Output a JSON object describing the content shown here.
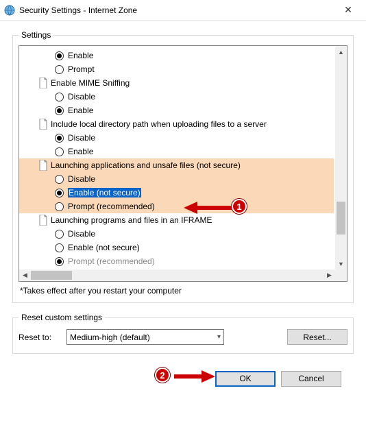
{
  "window": {
    "title": "Security Settings - Internet Zone",
    "close": "✕"
  },
  "settings": {
    "legend": "Settings",
    "groups": [
      {
        "type": "opt",
        "label": "Enable",
        "checked": true
      },
      {
        "type": "opt",
        "label": "Prompt",
        "checked": false
      },
      {
        "type": "grp",
        "label": "Enable MIME Sniffing"
      },
      {
        "type": "opt",
        "label": "Disable",
        "checked": false
      },
      {
        "type": "opt",
        "label": "Enable",
        "checked": true
      },
      {
        "type": "grp",
        "label": "Include local directory path when uploading files to a server"
      },
      {
        "type": "opt",
        "label": "Disable",
        "checked": true
      },
      {
        "type": "opt",
        "label": "Enable",
        "checked": false
      },
      {
        "type": "block_start"
      },
      {
        "type": "grp",
        "label": "Launching applications and unsafe files (not secure)"
      },
      {
        "type": "opt",
        "label": "Disable",
        "checked": false
      },
      {
        "type": "opt",
        "label": "Enable (not secure)",
        "checked": true,
        "selected": true
      },
      {
        "type": "opt",
        "label": "Prompt (recommended)",
        "checked": false
      },
      {
        "type": "block_end"
      },
      {
        "type": "grp",
        "label": "Launching programs and files in an IFRAME"
      },
      {
        "type": "opt",
        "label": "Disable",
        "checked": false
      },
      {
        "type": "opt",
        "label": "Enable (not secure)",
        "checked": false
      },
      {
        "type": "opt_partial",
        "label": "Prompt (recommended)",
        "checked": true
      }
    ],
    "footnote": "*Takes effect after you restart your computer"
  },
  "reset": {
    "legend": "Reset custom settings",
    "label": "Reset to:",
    "value": "Medium-high (default)",
    "button": "Reset..."
  },
  "buttons": {
    "ok": "OK",
    "cancel": "Cancel"
  },
  "callouts": {
    "one": "1",
    "two": "2"
  }
}
